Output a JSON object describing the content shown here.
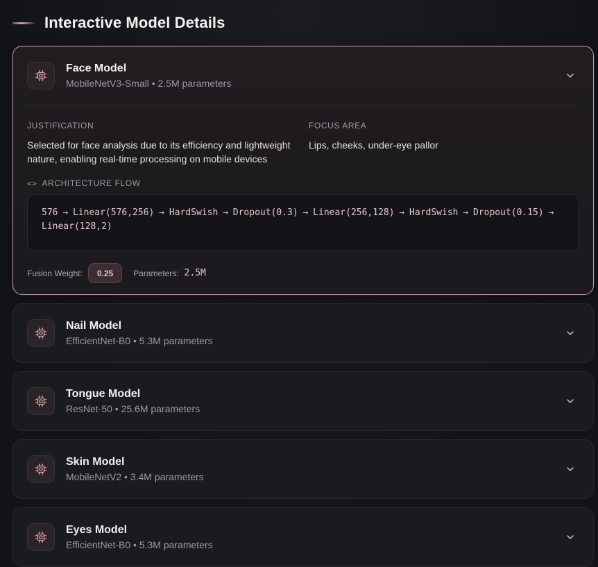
{
  "header": {
    "title": "Interactive Model Details"
  },
  "colors": {
    "accent": "#c79aa0",
    "code": "#e8c6cb",
    "background": "#121418"
  },
  "models": [
    {
      "title": "Face Model",
      "subtitle": "MobileNetV3-Small • 2.5M parameters",
      "icon": "chip-icon",
      "expanded": true,
      "justification_label": "JUSTIFICATION",
      "justification": "Selected for face analysis due to its efficiency and lightweight nature, enabling real-time processing on mobile devices",
      "focus_label": "FOCUS AREA",
      "focus": "Lips, cheeks, under-eye pallor",
      "architecture_label": "ARCHITECTURE FLOW",
      "architecture_icon": "<>",
      "architecture": "576 → Linear(576,256) → HardSwish → Dropout(0.3) → Linear(256,128) → HardSwish → Dropout(0.15) → Linear(128,2)",
      "fusion_label": "Fusion Weight:",
      "fusion_weight": "0.25",
      "params_label": "Parameters:",
      "params": "2.5M"
    },
    {
      "title": "Nail Model",
      "subtitle": "EfficientNet-B0 • 5.3M parameters",
      "icon": "chip-icon"
    },
    {
      "title": "Tongue Model",
      "subtitle": "ResNet-50 • 25.6M parameters",
      "icon": "chip-icon"
    },
    {
      "title": "Skin Model",
      "subtitle": "MobileNetV2 • 3.4M parameters",
      "icon": "chip-icon"
    },
    {
      "title": "Eyes Model",
      "subtitle": "EfficientNet-B0 • 5.3M parameters",
      "icon": "chip-icon"
    }
  ]
}
